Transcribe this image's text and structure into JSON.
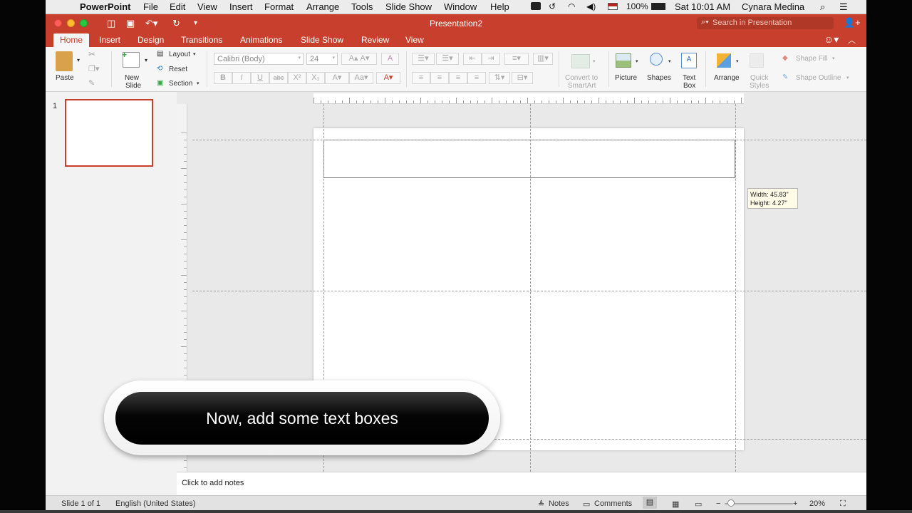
{
  "menubar": {
    "apple_glyph": "",
    "app_name": "PowerPoint",
    "items": [
      "File",
      "Edit",
      "View",
      "Insert",
      "Format",
      "Arrange",
      "Tools",
      "Slide Show",
      "Window",
      "Help"
    ],
    "battery": "100%",
    "clock": "Sat 10:01 AM",
    "user": "Cynara Medina"
  },
  "titlebar": {
    "title": "Presentation2",
    "search_placeholder": "Search in Presentation"
  },
  "tabs": [
    "Home",
    "Insert",
    "Design",
    "Transitions",
    "Animations",
    "Slide Show",
    "Review",
    "View"
  ],
  "ribbon": {
    "paste": "Paste",
    "new_slide": [
      "New",
      "Slide"
    ],
    "layout": "Layout",
    "reset": "Reset",
    "section": "Section",
    "font_name": "Calibri (Body)",
    "font_size": "24",
    "bold": "B",
    "italic": "I",
    "underline": "U",
    "strike": "abc",
    "superscript": "X²",
    "subscript": "X₂",
    "convert": [
      "Convert to",
      "SmartArt"
    ],
    "picture": "Picture",
    "shapes": "Shapes",
    "textbox": [
      "Text",
      "Box"
    ],
    "arrange": "Arrange",
    "quick_styles": [
      "Quick",
      "Styles"
    ],
    "shape_fill": "Shape Fill",
    "shape_outline": "Shape Outline"
  },
  "slide_pane": {
    "number": "1"
  },
  "size_tip": {
    "width": "Width: 45.83\"",
    "height": "Height: 4.27\""
  },
  "notes": {
    "placeholder": "Click to add notes"
  },
  "status": {
    "slide": "Slide 1 of 1",
    "language": "English (United States)",
    "notes": "Notes",
    "comments": "Comments",
    "zoom": "20%"
  },
  "callout": {
    "text": "Now, add some text boxes"
  },
  "colors": {
    "accent": "#c8402d",
    "ribbon": "#f6f6f6",
    "workspace": "#e9e9e9"
  }
}
